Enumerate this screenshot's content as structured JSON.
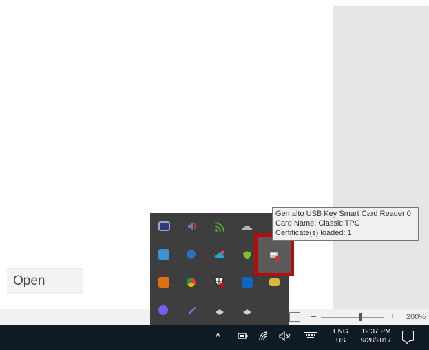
{
  "document": {
    "open_label": "Open"
  },
  "statusbar": {
    "zoom_minus": "–",
    "zoom_plus": "+",
    "zoom_level": "200%",
    "zoom_percent": 200
  },
  "taskbar": {
    "chevron": "^",
    "volume": "̸〈x",
    "lang_line1": "ENG",
    "lang_line2": "US",
    "time": "12:37 PM",
    "date": "9/28/2017"
  },
  "tooltip": {
    "line1": "Gemalto USB Key Smart Card Reader 0",
    "line2": "Card Name: Classic TPC",
    "line3": "Certificate(s) loaded: 1"
  },
  "tray_icons": [
    {
      "name": "monitor-icon",
      "color": "#9aa6c8"
    },
    {
      "name": "speaker-muted-icon",
      "color": "#8a8fa8"
    },
    {
      "name": "rss-icon",
      "color": "#4da832"
    },
    {
      "name": "onedrive-icon",
      "color": "#b8b8b8"
    },
    {
      "name": "globe-icon",
      "color": "#3a93d6"
    },
    {
      "name": "network-icon",
      "color": "#2f6fb7"
    },
    {
      "name": "cloud-sync-icon",
      "color": "#1ea7d6"
    },
    {
      "name": "check-shield-icon",
      "color": "#7bbd2c"
    },
    {
      "name": "smart-card-reader-icon",
      "color": "#aaaaaa"
    },
    {
      "name": "orange-app-icon",
      "color": "#e07016"
    },
    {
      "name": "chrome-icon",
      "color": "#db4437"
    },
    {
      "name": "shield-x-icon",
      "color": "#ffffff"
    },
    {
      "name": "outlook-icon",
      "color": "#0f65c0"
    },
    {
      "name": "mail-icon",
      "color": "#e3b341"
    },
    {
      "name": "viber-icon",
      "color": "#7360f2"
    },
    {
      "name": "feather-icon",
      "color": "#a166d8"
    },
    {
      "name": "usb-drive-icon",
      "color": "#cfcfcf"
    },
    {
      "name": "usb-drive-2-icon",
      "color": "#cfcfcf"
    }
  ]
}
